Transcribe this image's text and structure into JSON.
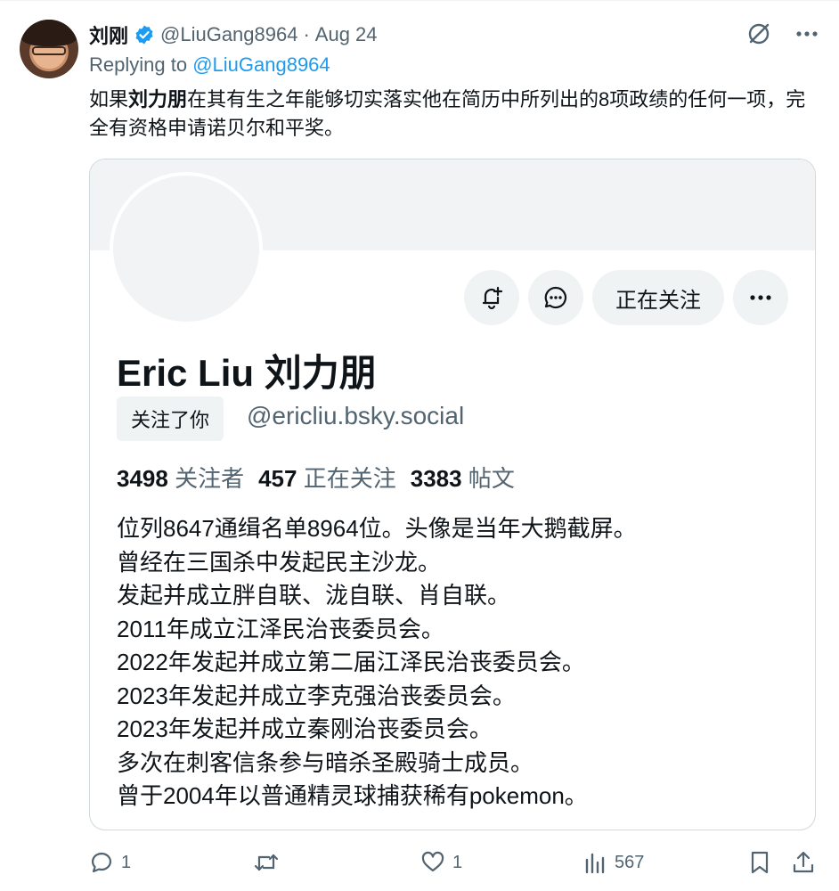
{
  "tweet": {
    "author_name": "刘刚",
    "author_handle": "@LiuGang8964",
    "separator": "·",
    "date": "Aug 24",
    "replying_prefix": "Replying to",
    "replying_to": "@LiuGang8964",
    "text_part1": "如果",
    "text_bold": "刘力朋",
    "text_part2": "在其有生之年能够切实落实他在简历中所列出的8项政绩的任何一项，完全有资格申请诺贝尔和平奖。"
  },
  "card": {
    "display_name": "Eric Liu 刘力朋",
    "follows_you": "关注了你",
    "handle": "@ericliu.bsky.social",
    "following_button": "正在关注",
    "stats": [
      {
        "value": "3498",
        "label": "关注者"
      },
      {
        "value": "457",
        "label": "正在关注"
      },
      {
        "value": "3383",
        "label": "帖文"
      }
    ],
    "bio": [
      "位列8647通缉名单8964位。头像是当年大鹅截屏。",
      "曾经在三国杀中发起民主沙龙。",
      "发起并成立胖自联、泷自联、肖自联。",
      "2011年成立江泽民治丧委员会。",
      "2022年发起并成立第二届江泽民治丧委员会。",
      "2023年发起并成立李克强治丧委员会。",
      "2023年发起并成立秦刚治丧委员会。",
      "多次在刺客信条参与暗杀圣殿骑士成员。",
      "曾于2004年以普通精灵球捕获稀有pokemon。"
    ]
  },
  "footer": {
    "replies": "1",
    "retweets": "",
    "likes": "1",
    "views": "567"
  },
  "colors": {
    "accent": "#1d9bf0",
    "muted": "#536471",
    "text": "#0f1419",
    "button_bg": "#eff3f4",
    "border": "#cfd9de"
  }
}
